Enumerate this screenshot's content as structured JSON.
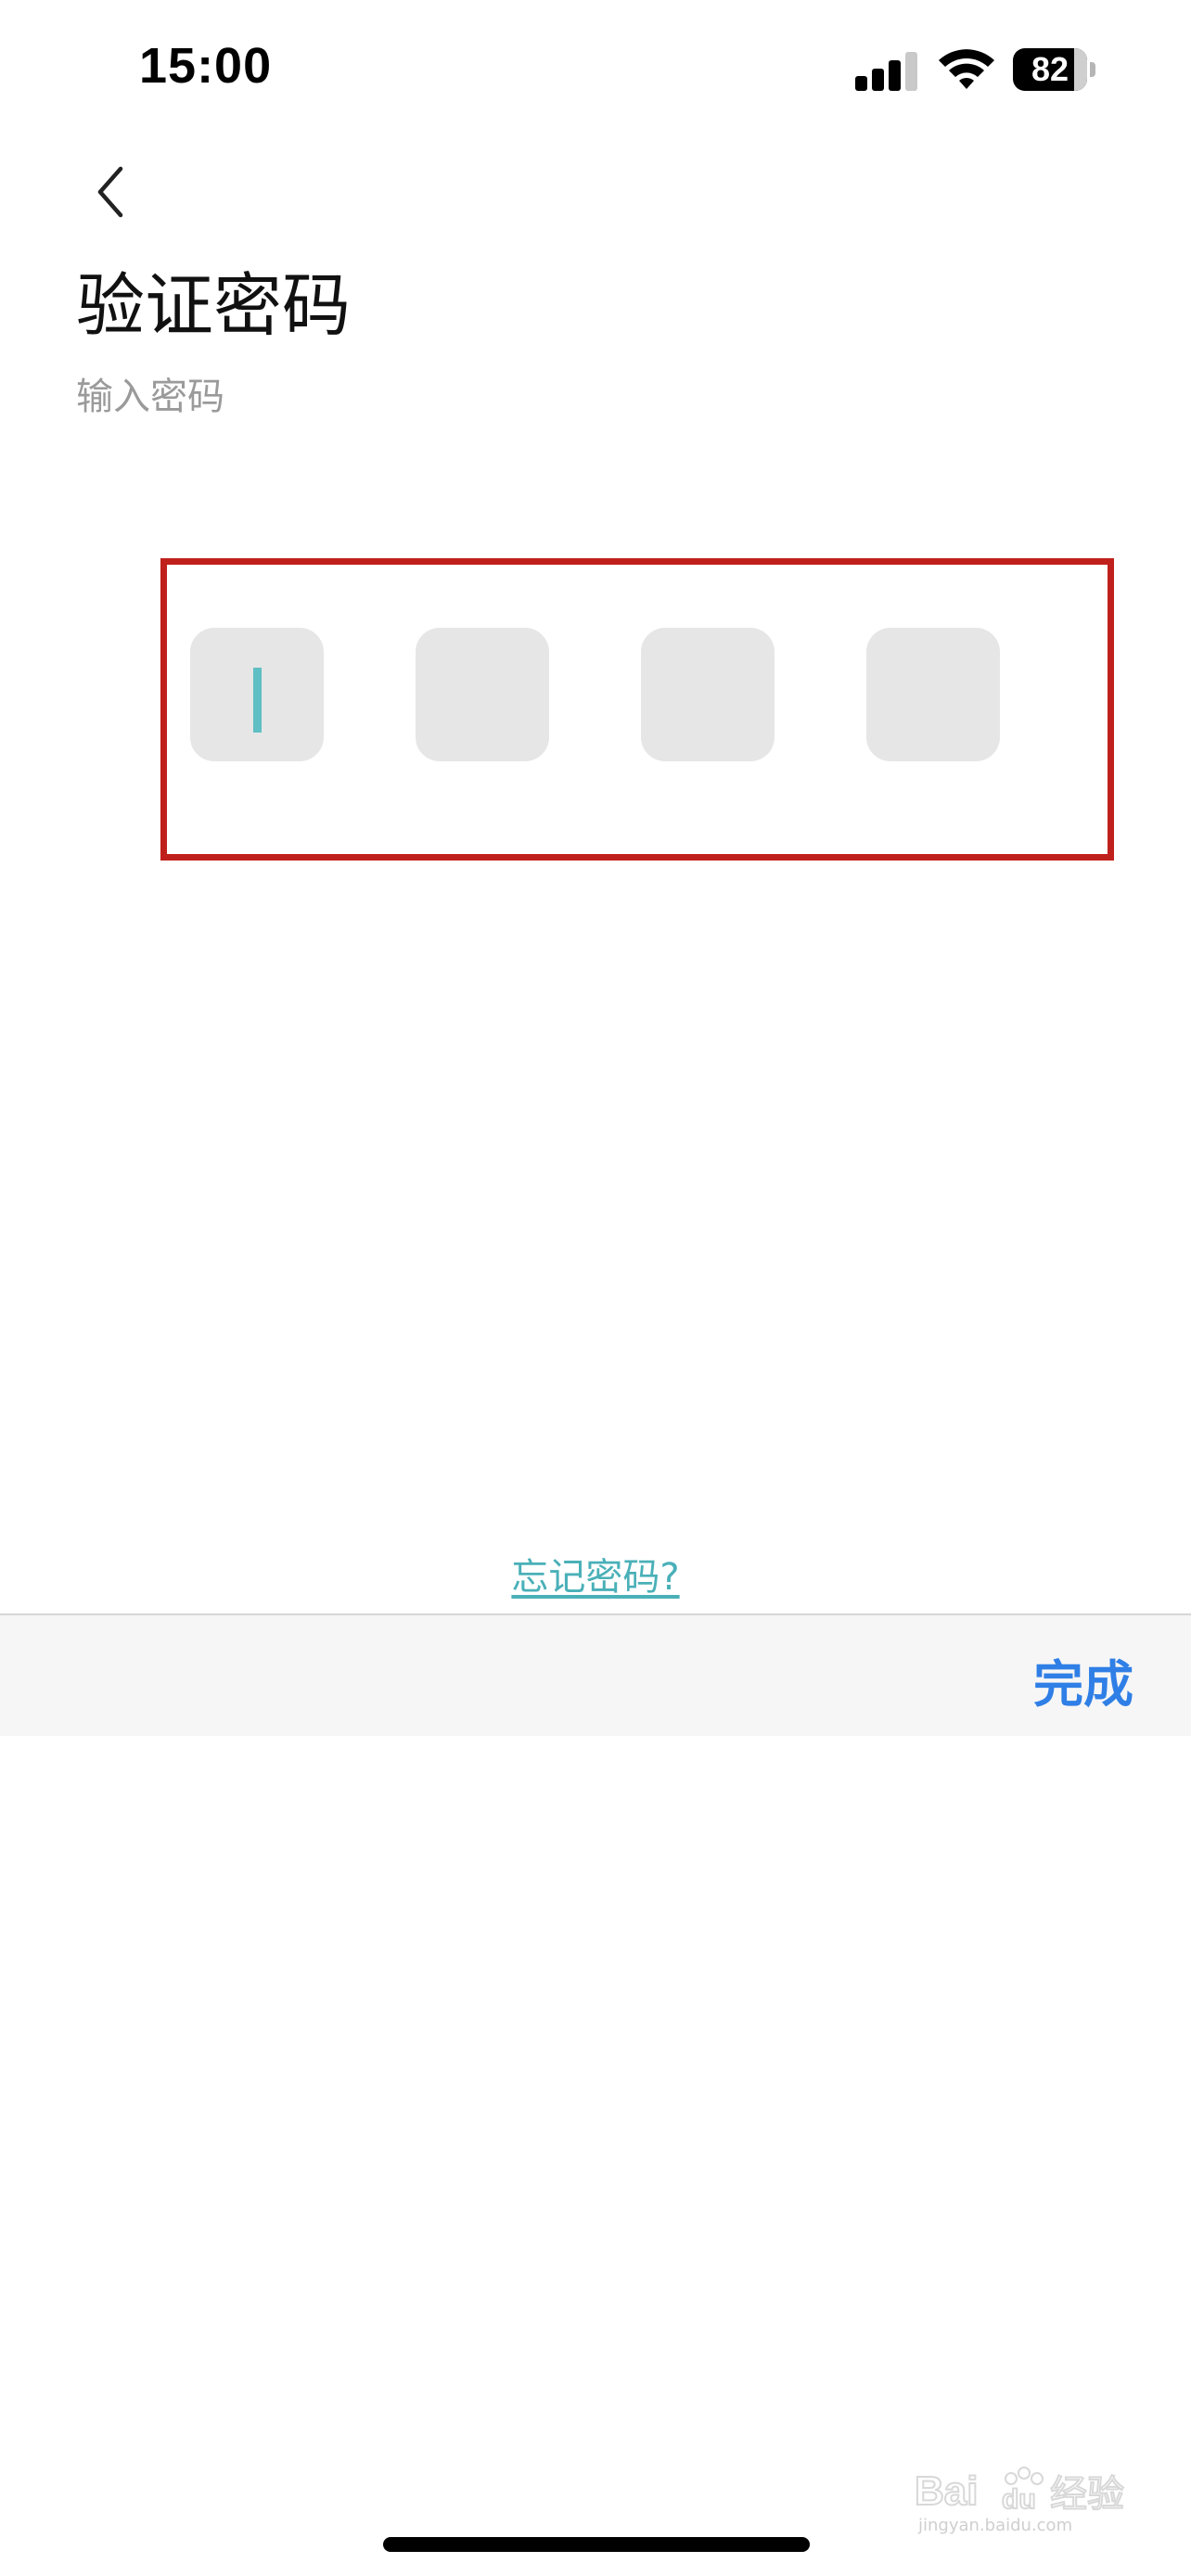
{
  "status_bar": {
    "time": "15:00",
    "battery_level": "82",
    "battery_fraction": 0.82,
    "signal_bars_active": 3
  },
  "header": {
    "back_icon": "chevron-left-icon",
    "title": "验证密码",
    "subtitle": "输入密码"
  },
  "pin_input": {
    "length": 4,
    "filled": 0,
    "active_index": 0,
    "cursor_color": "#5fbfc4",
    "highlight_color": "#c0201c"
  },
  "forgot_link": {
    "label": "忘记密码?"
  },
  "keyboard_toolbar": {
    "done_label": "完成",
    "accent_color": "#2f7fe6"
  },
  "watermark": {
    "text": "Baidu经验",
    "url_text": "jingyan.baidu.com"
  }
}
